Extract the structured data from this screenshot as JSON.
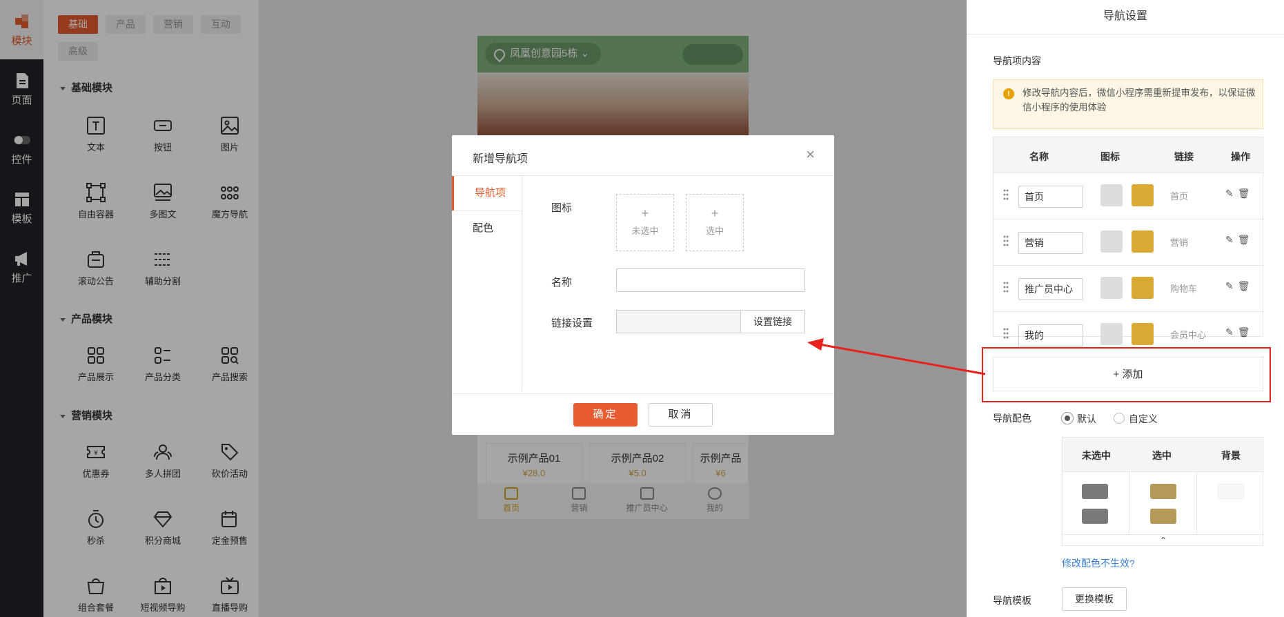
{
  "leftnav": {
    "items": [
      {
        "label": "模块",
        "icon": "modules-icon"
      },
      {
        "label": "页面",
        "icon": "page-icon"
      },
      {
        "label": "控件",
        "icon": "toggle-icon"
      },
      {
        "label": "模板",
        "icon": "template-icon"
      },
      {
        "label": "推广",
        "icon": "megaphone-icon"
      }
    ]
  },
  "modpanel": {
    "tabs": [
      "基础",
      "产品",
      "营销",
      "互动",
      "高级"
    ],
    "sections": [
      {
        "title": "基础模块",
        "items": [
          "文本",
          "按钮",
          "图片",
          "自由容器",
          "多图文",
          "魔方导航",
          "滚动公告",
          "辅助分割"
        ]
      },
      {
        "title": "产品模块",
        "items": [
          "产品展示",
          "产品分类",
          "产品搜索"
        ]
      },
      {
        "title": "营销模块",
        "items": [
          "优惠券",
          "多人拼团",
          "砍价活动",
          "秒杀",
          "积分商城",
          "定金预售",
          "组合套餐",
          "短视频导购",
          "直播导购"
        ]
      }
    ]
  },
  "phone": {
    "location": "凤凰创意园5栋",
    "products": [
      "示例产品01",
      "示例产品02",
      "示例产品"
    ],
    "prices": [
      "¥28.0",
      "¥5.0",
      "¥6"
    ],
    "tabbar": [
      "首页",
      "营销",
      "推广员中心",
      "我的"
    ]
  },
  "dialog": {
    "title": "新增导航项",
    "close": "×",
    "side_tabs": [
      "导航项",
      "配色"
    ],
    "icon_label": "图标",
    "icon_unselected": "未选中",
    "icon_selected": "选中",
    "plus": "+",
    "name_label": "名称",
    "name_value": "",
    "link_label": "链接设置",
    "link_button": "设置链接",
    "ok": "确定",
    "cancel": "取消"
  },
  "rpanel": {
    "title": "导航设置",
    "section": "导航项内容",
    "warning": "修改导航内容后，微信小程序需重新提审发布，以保证微信小程序的使用体验",
    "table_headers": [
      "名称",
      "图标",
      "链接",
      "操作"
    ],
    "rows": [
      {
        "name": "首页",
        "link": "首页"
      },
      {
        "name": "营销",
        "link": "营销"
      },
      {
        "name": "推广员中心",
        "link": "购物车"
      },
      {
        "name": "我的",
        "link": "会员中心"
      }
    ],
    "add": "+ 添加",
    "color_label": "导航配色",
    "radio_default": "默认",
    "radio_custom": "自定义",
    "color_headers": [
      "未选中",
      "选中",
      "背景"
    ],
    "colors": {
      "unselected": "#7a7a7a",
      "selected": "#b39a5a",
      "background": "#f7f7f7"
    },
    "fix_link": "修改配色不生效?",
    "template_label": "导航模板",
    "template_button": "更换模板"
  },
  "colors": {
    "accent": "#e55b2f",
    "warning_bg": "#fdf6e4",
    "annotation": "#e8211c"
  }
}
